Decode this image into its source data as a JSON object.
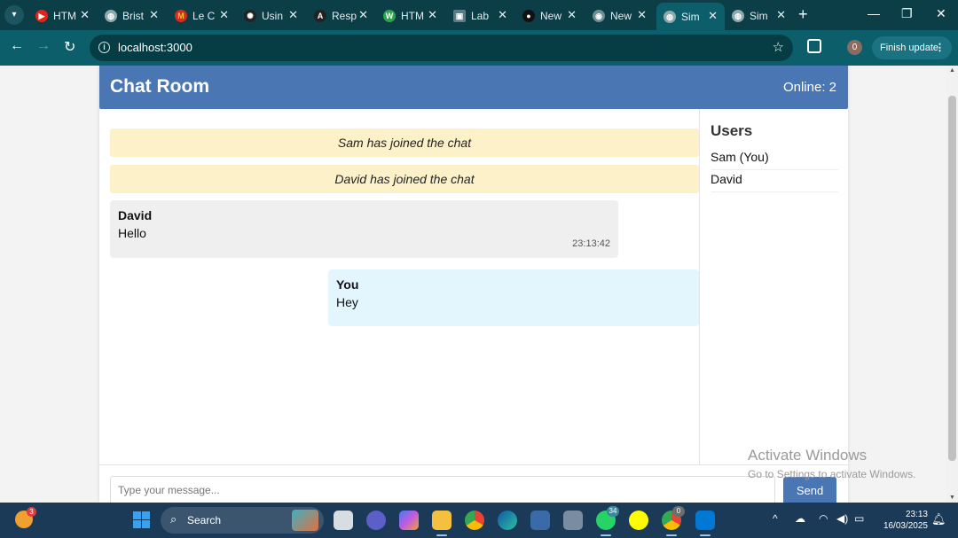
{
  "browser": {
    "tabs": [
      {
        "label": "HTM",
        "icon": "youtube-icon",
        "color": "#e62117"
      },
      {
        "label": "Brist",
        "icon": "globe-icon",
        "color": "#8fa9ad"
      },
      {
        "label": "Le C",
        "icon": "mcdonalds-icon",
        "color": "#d42a1f"
      },
      {
        "label": "Usin",
        "icon": "openai-icon",
        "color": "#222222"
      },
      {
        "label": "Resp",
        "icon": "angular-icon",
        "color": "#222222"
      },
      {
        "label": "HTM",
        "icon": "w-icon",
        "color": "#2da44e"
      },
      {
        "label": "Lab",
        "icon": "image-icon",
        "color": "#5b7c82"
      },
      {
        "label": "New",
        "icon": "github-icon",
        "color": "#111111"
      },
      {
        "label": "New",
        "icon": "chrome-icon",
        "color": "#6f8f94"
      },
      {
        "label": "Sim",
        "icon": "globe-icon",
        "color": "#8fa9ad"
      },
      {
        "label": "Sim",
        "icon": "globe-icon",
        "color": "#8fa9ad"
      }
    ],
    "active_tab": 9,
    "url": "localhost:3000",
    "profile_initial": "0",
    "update_label": "Finish update"
  },
  "chat": {
    "title": "Chat Room",
    "online": "Online: 2",
    "system_messages": [
      "Sam has joined the chat",
      "David has joined the chat"
    ],
    "messages": [
      {
        "sender": "David",
        "text": "Hello",
        "time": "23:13:42"
      },
      {
        "sender": "You",
        "text": "Hey",
        "time": ""
      }
    ],
    "users_title": "Users",
    "users": [
      "Sam (You)",
      "David"
    ],
    "input_placeholder": "Type your message...",
    "send_label": "Send"
  },
  "watermark": {
    "line1": "Activate Windows",
    "line2": "Go to Settings to activate Windows."
  },
  "taskbar": {
    "weather_badge": "3",
    "search_label": "Search",
    "whatsapp_badge": "34",
    "chrome_badge": "0",
    "time": "23:13",
    "date": "16/03/2025"
  },
  "colors": {
    "header": "#4a76b3",
    "system_bg": "#fcf1c8",
    "mine_bg": "#e3f5fd",
    "other_bg": "#efefef",
    "browser_frame": "#0d5e6b"
  }
}
